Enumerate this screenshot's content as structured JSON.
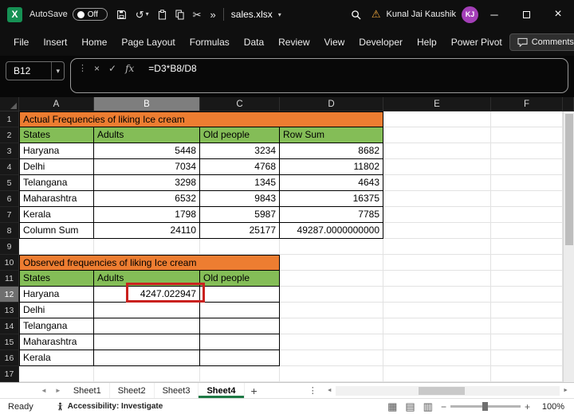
{
  "titlebar": {
    "autosave_label": "AutoSave",
    "autosave_state": "Off",
    "filename": "sales.xlsx",
    "user_name": "Kunal Jai Kaushik",
    "user_initials": "KJ"
  },
  "ribbon": {
    "tabs": [
      "File",
      "Insert",
      "Home",
      "Page Layout",
      "Formulas",
      "Data",
      "Review",
      "View",
      "Developer",
      "Help",
      "Power Pivot"
    ],
    "comments_label": "Comments"
  },
  "formula_bar": {
    "name_box": "B12",
    "fx_label": "fx",
    "formula": "=D3*B8/D8"
  },
  "grid": {
    "columns": [
      "A",
      "B",
      "C",
      "D",
      "E",
      "F"
    ],
    "selected_column": "B",
    "selected_row": 12,
    "row_count": 17,
    "selected_cell": "B12"
  },
  "tables": {
    "actual": {
      "title": "Actual Frequencies of liking Ice cream",
      "headers": [
        "States",
        "Adults",
        "Old people",
        "Row Sum"
      ],
      "rows": [
        [
          "Haryana",
          "5448",
          "3234",
          "8682"
        ],
        [
          "Delhi",
          "7034",
          "4768",
          "11802"
        ],
        [
          "Telangana",
          "3298",
          "1345",
          "4643"
        ],
        [
          "Maharashtra",
          "6532",
          "9843",
          "16375"
        ],
        [
          "Kerala",
          "1798",
          "5987",
          "7785"
        ],
        [
          "Column Sum",
          "24110",
          "25177",
          "49287.0000000000"
        ]
      ]
    },
    "observed": {
      "title": "Observed frequencies of liking Ice cream",
      "headers": [
        "States",
        "Adults",
        "Old people"
      ],
      "rows": [
        [
          "Haryana",
          "4247.022947",
          ""
        ],
        [
          "Delhi",
          "",
          ""
        ],
        [
          "Telangana",
          "",
          ""
        ],
        [
          "Maharashtra",
          "",
          ""
        ],
        [
          "Kerala",
          "",
          ""
        ]
      ]
    }
  },
  "sheet_tabs": {
    "tabs": [
      "Sheet1",
      "Sheet2",
      "Sheet3",
      "Sheet4"
    ],
    "active": "Sheet4",
    "add_label": "+"
  },
  "status_bar": {
    "ready": "Ready",
    "accessibility": "Accessibility: Investigate",
    "zoom": "100%"
  },
  "icons": {
    "excel_logo": "X",
    "dropdown": "▾",
    "undo": "↺",
    "cut": "✂",
    "more": "»",
    "warning": "⚠",
    "minimize": "─",
    "close": "×",
    "cancel": "×",
    "check": "✓",
    "dots": "⋮",
    "nav_left": "◄",
    "nav_right": "►",
    "view_normal": "▦",
    "view_layout": "▤",
    "view_break": "▥",
    "zoom_out": "−",
    "zoom_in": "+"
  },
  "colors": {
    "banner_orange": "#ED7D31",
    "header_green": "#84BD57",
    "highlight_red": "#C9211E",
    "excel_green": "#1E7A45"
  }
}
